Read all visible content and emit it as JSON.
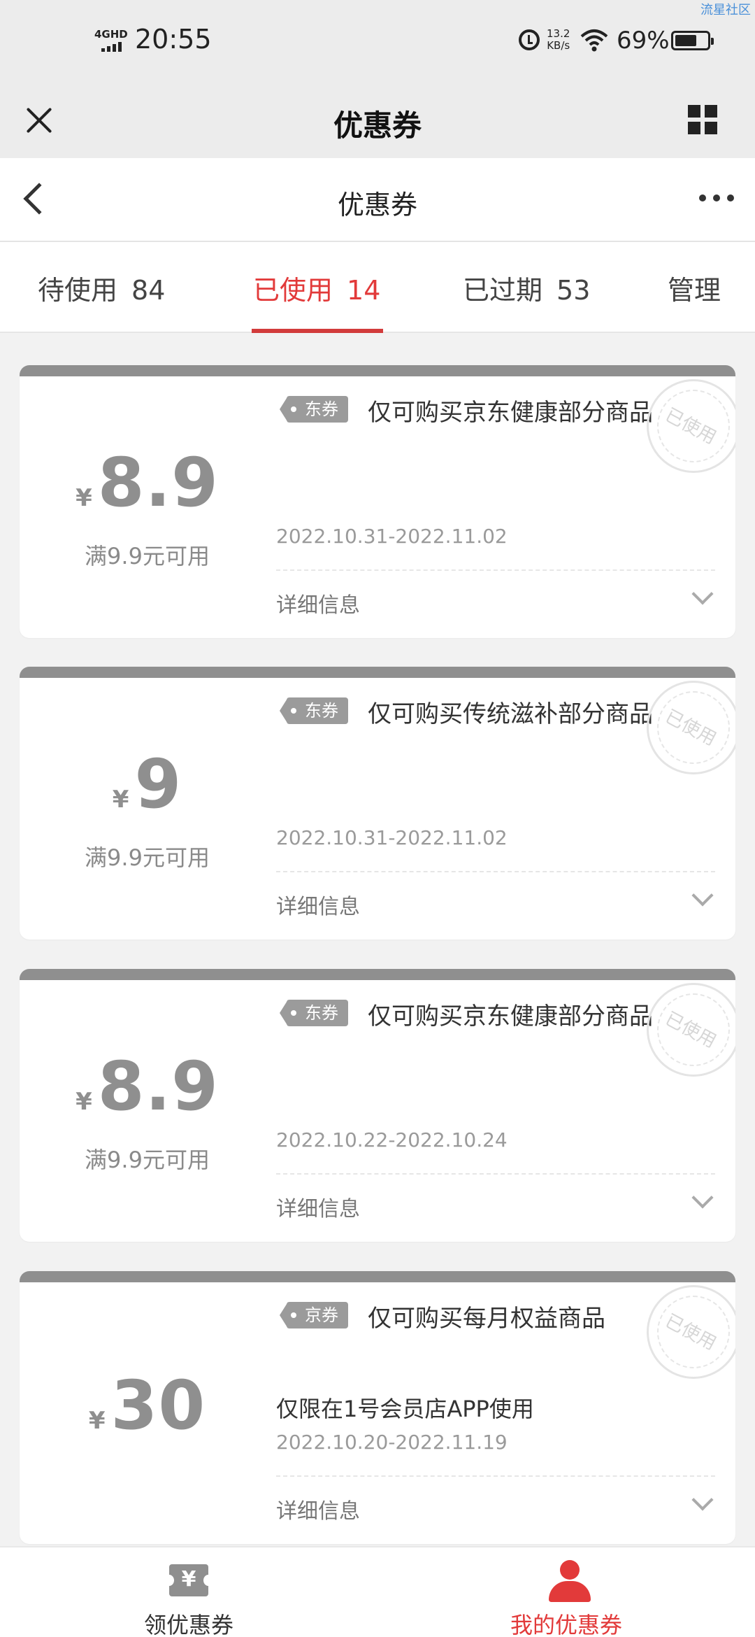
{
  "watermark": "流星社区",
  "status": {
    "network": "4GHD",
    "time": "20:55",
    "speed_value": "13.2",
    "speed_unit": "KB/s",
    "battery": "69%"
  },
  "miniapp": {
    "title": "优惠券"
  },
  "nav": {
    "title": "优惠券"
  },
  "tabs": [
    {
      "label": "待使用",
      "count": "84"
    },
    {
      "label": "已使用",
      "count": "14"
    },
    {
      "label": "已过期",
      "count": "53"
    },
    {
      "label": "管理"
    }
  ],
  "coupons": [
    {
      "currency": "¥",
      "amount": "8.9",
      "condition": "满9.9元可用",
      "tag": "东券",
      "title": "仅可购买京东健康部分商品",
      "limit": "",
      "date": "2022.10.31-2022.11.02",
      "detail": "详细信息",
      "stamp": "已使用"
    },
    {
      "currency": "¥",
      "amount": "9",
      "condition": "满9.9元可用",
      "tag": "东券",
      "title": "仅可购买传统滋补部分商品",
      "limit": "",
      "date": "2022.10.31-2022.11.02",
      "detail": "详细信息",
      "stamp": "已使用"
    },
    {
      "currency": "¥",
      "amount": "8.9",
      "condition": "满9.9元可用",
      "tag": "东券",
      "title": "仅可购买京东健康部分商品",
      "limit": "",
      "date": "2022.10.22-2022.10.24",
      "detail": "详细信息",
      "stamp": "已使用"
    },
    {
      "currency": "¥",
      "amount": "30",
      "condition": "",
      "tag": "京券",
      "title": "仅可购买每月权益商品",
      "limit": "仅限在1号会员店APP使用",
      "date": "2022.10.20-2022.11.19",
      "detail": "详细信息",
      "stamp": "已使用"
    }
  ],
  "bottom_nav": [
    {
      "label": "领优惠券",
      "icon": "coupon-ticket-icon",
      "icon_glyph": "¥"
    },
    {
      "label": "我的优惠券",
      "icon": "user-icon"
    }
  ],
  "colors": {
    "accent": "#e23a3a",
    "used_grey": "#8f8f8f"
  }
}
